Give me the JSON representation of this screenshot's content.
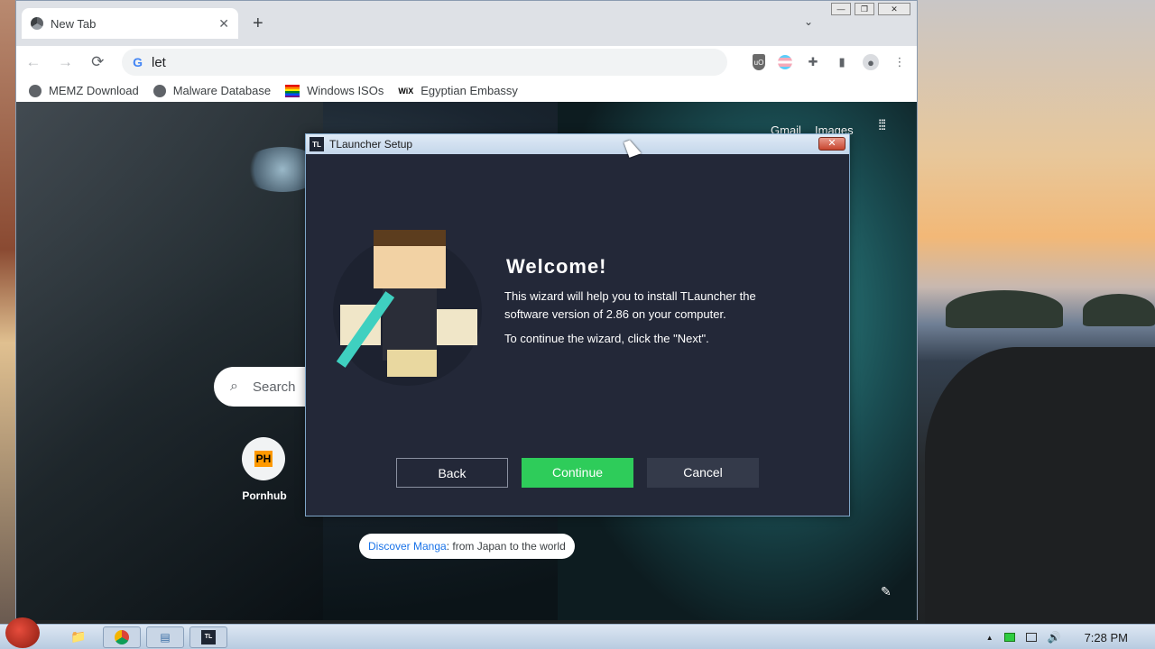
{
  "browser": {
    "tab": {
      "title": "New Tab",
      "close": "✕"
    },
    "new_tab": "+",
    "tab_menu": "⌄",
    "window_controls": {
      "minimize": "—",
      "maximize": "❐",
      "close": "✕"
    },
    "omnibox": {
      "text": "let"
    },
    "bookmarks": [
      {
        "label": "MEMZ Download",
        "icon": "globe"
      },
      {
        "label": "Malware Database",
        "icon": "globe"
      },
      {
        "label": "Windows ISOs",
        "icon": "rainbow-flag"
      },
      {
        "label": "Egyptian Embassy",
        "icon": "wix"
      }
    ],
    "wix_label": "WiX"
  },
  "newtab": {
    "gmail": "Gmail",
    "images": "Images",
    "search_placeholder": "Search",
    "shortcut": {
      "badge": "PH",
      "label": "Pornhub"
    },
    "chip": {
      "link": "Discover Manga",
      "rest": ": from Japan to the world"
    }
  },
  "dialog": {
    "logo": "TL",
    "title": "TLauncher Setup",
    "close": "✕",
    "welcome": "Welcome!",
    "line1": "This wizard will help you to install TLauncher the software version of 2.86 on your computer.",
    "line2": "To continue the wizard, click the \"Next\".",
    "back": "Back",
    "continue": "Continue",
    "cancel": "Cancel"
  },
  "taskbar": {
    "tl_label": "TL",
    "clock": "7:28 PM",
    "tray_arrow": "▲",
    "speaker": "🔊"
  },
  "colors": {
    "continue": "#2ecc5a",
    "dialog_bg": "#232838"
  }
}
